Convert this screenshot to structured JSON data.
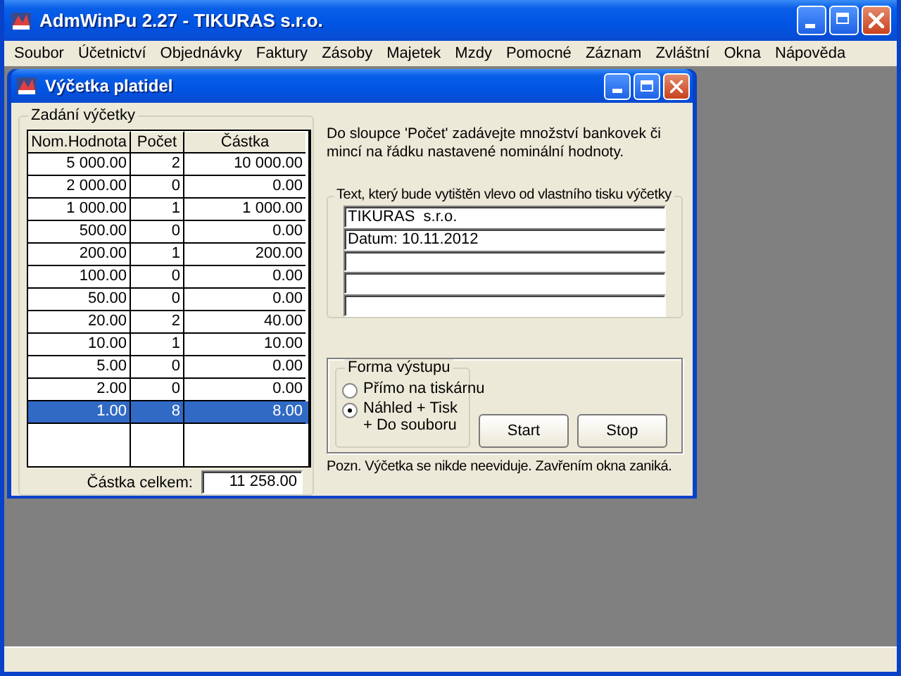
{
  "app_window": {
    "title": "AdmWinPu 2.27 - TIKURAS  s.r.o."
  },
  "menu": [
    "Soubor",
    "Účetnictví",
    "Objednávky",
    "Faktury",
    "Zásoby",
    "Majetek",
    "Mzdy",
    "Pomocné",
    "Záznam",
    "Zvláštní",
    "Okna",
    "Nápověda"
  ],
  "child_window": {
    "title": "Výčetka platidel"
  },
  "count_group": {
    "title": "Zadání výčetky",
    "table": {
      "columns": [
        "Nom.Hodnota",
        "Počet",
        "Částka"
      ],
      "rows": [
        {
          "cells": [
            "5 000.00",
            "2",
            "10 000.00"
          ],
          "selected": false
        },
        {
          "cells": [
            "2 000.00",
            "0",
            "0.00"
          ],
          "selected": false
        },
        {
          "cells": [
            "1 000.00",
            "1",
            "1 000.00"
          ],
          "selected": false
        },
        {
          "cells": [
            "500.00",
            "0",
            "0.00"
          ],
          "selected": false
        },
        {
          "cells": [
            "200.00",
            "1",
            "200.00"
          ],
          "selected": false
        },
        {
          "cells": [
            "100.00",
            "0",
            "0.00"
          ],
          "selected": false
        },
        {
          "cells": [
            "50.00",
            "0",
            "0.00"
          ],
          "selected": false
        },
        {
          "cells": [
            "20.00",
            "2",
            "40.00"
          ],
          "selected": false
        },
        {
          "cells": [
            "10.00",
            "1",
            "10.00"
          ],
          "selected": false
        },
        {
          "cells": [
            "5.00",
            "0",
            "0.00"
          ],
          "selected": false
        },
        {
          "cells": [
            "2.00",
            "0",
            "0.00"
          ],
          "selected": false
        },
        {
          "cells": [
            "1.00",
            "8",
            "8.00"
          ],
          "selected": true
        }
      ]
    },
    "total_label": "Částka celkem:",
    "total_value": "11 258.00"
  },
  "instructions": "Do sloupce 'Počet' zadávejte množství bankovek či mincí na řádku nastavené nominální hodnoty.",
  "print_text_group": {
    "title": "Text, který bude vytištěn vlevo od vlastního tisku výčetky",
    "lines": [
      "TIKURAS  s.r.o.",
      "Datum: 10.11.2012"
    ]
  },
  "output_group": {
    "title": "Forma výstupu",
    "options": [
      {
        "label": "Přímo na tiskárnu",
        "selected": false
      },
      {
        "label": "Náhled + Tisk\n+ Do souboru",
        "selected": true
      }
    ]
  },
  "buttons": [
    "Start",
    "Stop"
  ],
  "note": "Pozn. Výčetka se nikde neeviduje. Zavřením okna zaniká."
}
